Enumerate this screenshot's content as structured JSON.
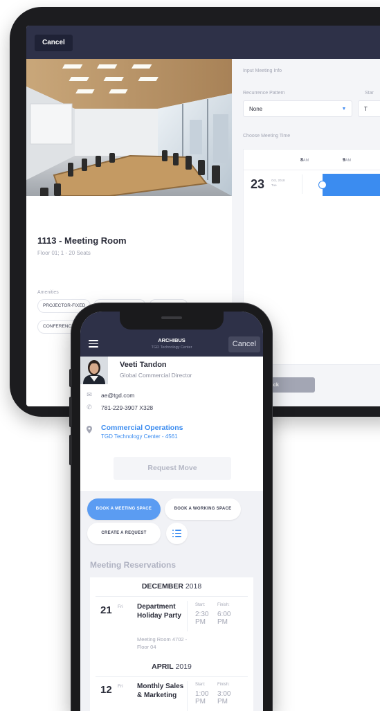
{
  "tablet": {
    "cancel_label": "Cancel",
    "room": {
      "name": "1113 - Meeting Room",
      "subtitle": "Floor 01; 1 - 20 Seats",
      "amenities_label": "Amenities",
      "amenities": [
        "PROJECTOR-FIXED",
        "WIFI CONNECTION",
        "MONITOR-LG",
        "CONFERENCE"
      ]
    },
    "input_section_label": "Input Meeting Info",
    "recurrence_label": "Recurrence Pattern",
    "recurrence_value": "None",
    "start_label": "Star",
    "start_value": "T",
    "choose_time_label": "Choose Meeting Time",
    "hours": [
      {
        "num": "8",
        "suffix": "AM"
      },
      {
        "num": "9",
        "suffix": "AM"
      }
    ],
    "day": {
      "number": "23",
      "meta_line1": "Oct, 2018",
      "meta_line2": "Tue"
    },
    "back_label": "Back"
  },
  "phone": {
    "app_title": "ARCHIBUS",
    "app_subtitle": "TGD Technology Center",
    "cancel_label": "Cancel",
    "profile": {
      "name": "Veeti Tandon",
      "role": "Global Commercial Director",
      "email": "ae@tgd.com",
      "phone": "781-229-3907 X328",
      "department": "Commercial Operations",
      "location": "TGD Technology Center - 4561"
    },
    "request_move_label": "Request Move",
    "actions": {
      "book_meeting": "BOOK A MEETING SPACE",
      "book_working": "BOOK A WORKING SPACE",
      "create_request": "CREATE A REQUEST"
    },
    "reservations_title": "Meeting Reservations",
    "reservations": [
      {
        "month": "DECEMBER",
        "year": "2018",
        "day": "21",
        "dow": "Fri",
        "title": "Department Holiday Party",
        "location": "Meeting Room 4702 - Floor 04",
        "start_label": "Start:",
        "start_time": "2:30 PM",
        "finish_label": "Finish:",
        "finish_time": "6:00 PM"
      },
      {
        "month": "APRIL",
        "year": "2019",
        "day": "12",
        "dow": "Fri",
        "title": "Monthly Sales & Marketing",
        "location": "",
        "start_label": "Start:",
        "start_time": "1:00 PM",
        "finish_label": "Finish:",
        "finish_time": "3:00 PM"
      }
    ]
  },
  "colors": {
    "header_navy": "#2e3148",
    "accent_blue": "#3b8cf0",
    "pill_blue": "#5b9cf2",
    "muted_gray": "#a3a6b4"
  },
  "icons": [
    "menu-icon",
    "email-icon",
    "phone-icon",
    "location-pin-icon",
    "list-icon",
    "dropdown-arrow-icon"
  ]
}
